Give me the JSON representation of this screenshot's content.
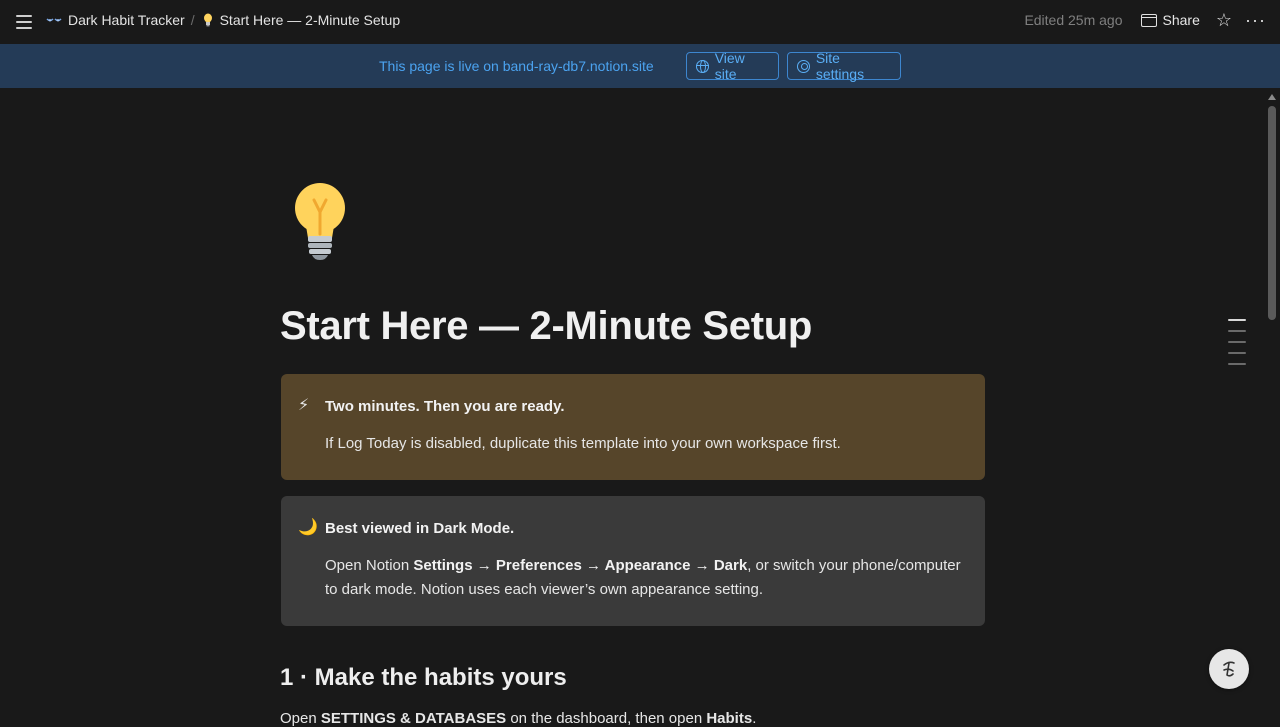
{
  "topbar": {
    "breadcrumb": [
      {
        "label": "Dark Habit Tracker",
        "icon": "eyes-icon"
      },
      {
        "label": "Start Here — 2-Minute Setup",
        "icon": "lightbulb-icon"
      }
    ],
    "separator": "/",
    "edited": "Edited 25m ago",
    "share_label": "Share"
  },
  "banner": {
    "text": "This page is live on band-ray-db7.notion.site",
    "view_site_label": "View site",
    "site_settings_label": "Site settings",
    "color": "#4ba3f0"
  },
  "page": {
    "icon": "lightbulb-icon",
    "title": "Start Here — 2-Minute Setup",
    "callouts": [
      {
        "icon": "⚡",
        "title": "Two minutes. Then you are ready.",
        "body": "If Log Today is disabled, duplicate this template into your own workspace first.",
        "color": "#56452a"
      },
      {
        "icon": "🌙",
        "title": "Best viewed in Dark Mode.",
        "body_parts": {
          "prefix": "Open Notion ",
          "settings": "Settings",
          "arrow1": " → ",
          "preferences": "Preferences",
          "arrow2": " → ",
          "appearance": "Appearance",
          "arrow3": " → ",
          "dark": "Dark",
          "suffix": ", or switch your phone/computer to dark mode. Notion uses each viewer’s own appearance setting."
        },
        "color": "#3a3a3a"
      }
    ],
    "section_heading": "1 · Make the habits yours",
    "section_para": {
      "prefix": "Open ",
      "bold1": "SETTINGS & DATABASES",
      "middle": " on the dashboard, then open ",
      "bold2": "Habits",
      "suffix": "."
    }
  },
  "help_button_icon": "help-icon"
}
